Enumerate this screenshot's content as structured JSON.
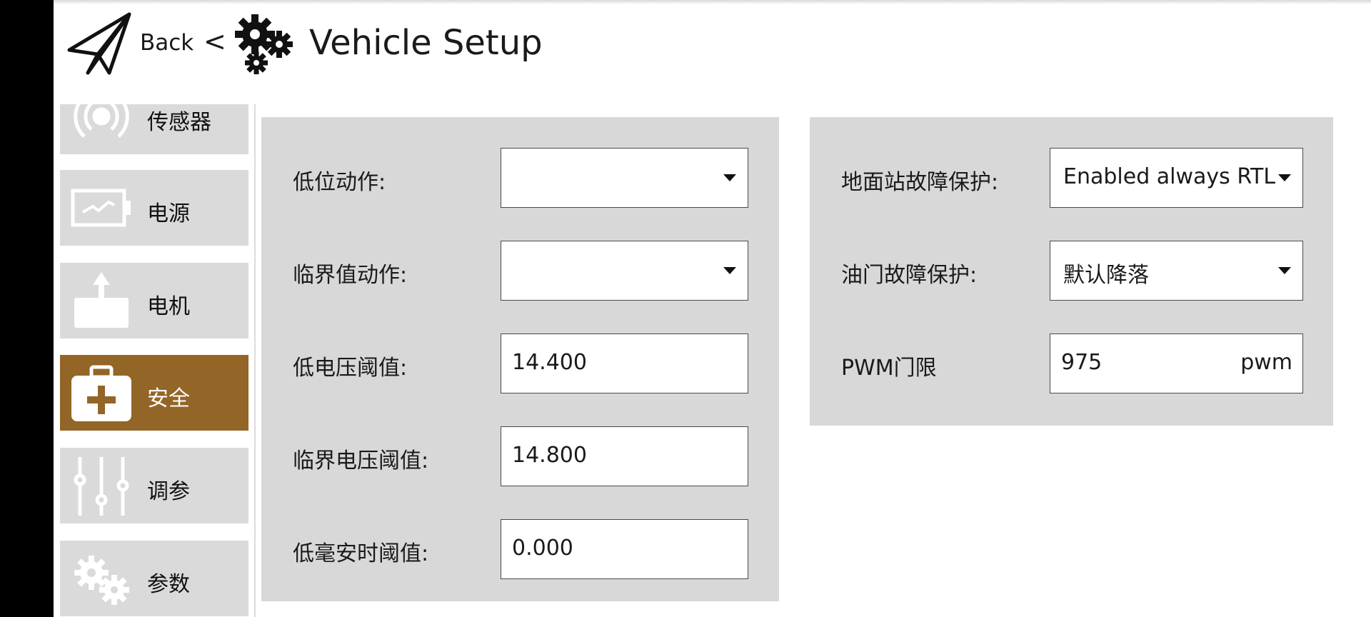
{
  "header": {
    "back_label": "Back",
    "separator": "<",
    "title": "Vehicle Setup"
  },
  "sidebar": {
    "items": [
      {
        "label": "传感器",
        "icon": "sensor-icon",
        "active": false
      },
      {
        "label": "电源",
        "icon": "battery-icon",
        "active": false
      },
      {
        "label": "电机",
        "icon": "motor-icon",
        "active": false
      },
      {
        "label": "安全",
        "icon": "first-aid-icon",
        "active": true
      },
      {
        "label": "调参",
        "icon": "sliders-icon",
        "active": false
      },
      {
        "label": "参数",
        "icon": "gears-icon",
        "active": false
      }
    ]
  },
  "battery_panel": {
    "low_action": {
      "label": "低位动作:",
      "value": ""
    },
    "critical_action": {
      "label": "临界值动作:",
      "value": ""
    },
    "low_voltage": {
      "label": "低电压阈值:",
      "value": "14.400"
    },
    "critical_voltage": {
      "label": "临界电压阈值:",
      "value": "14.800"
    },
    "low_mah": {
      "label": "低毫安时阈值:",
      "value": "0.000"
    }
  },
  "failsafe_panel": {
    "gcs_failsafe": {
      "label": "地面站故障保护:",
      "value": "Enabled always RTL"
    },
    "throttle_failsafe": {
      "label": "油门故障保护:",
      "value": "默认降落"
    },
    "pwm_threshold": {
      "label": "PWM门限",
      "value": "975",
      "unit": "pwm"
    }
  },
  "colors": {
    "active_item": "#936526",
    "panel_bg": "#d8d8d8",
    "item_bg": "#dadada"
  }
}
